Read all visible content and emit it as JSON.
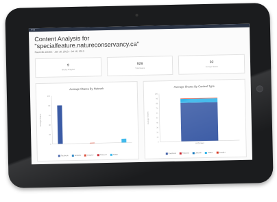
{
  "status_bar": {
    "left": "iPad",
    "center": "",
    "right": ""
  },
  "header": {
    "title_line1": "Content Analysis for",
    "title_line2": "\"specialfeature.natureconservancy.ca\"",
    "subtitle": "Past 10k articles · Jan 16, 2013 – Jul 16, 2013"
  },
  "summary_cards": [
    {
      "value": "9",
      "label": "Articles Analyzed"
    },
    {
      "value": "828",
      "label": "Total Shares"
    },
    {
      "value": "92",
      "label": "Average Shares"
    }
  ],
  "colors": {
    "facebook": "#3b5ba5",
    "google_plus": "#d9412b",
    "linkedin": "#1a7bbf",
    "twitter": "#31b4ea",
    "pinterest": "#c8232c",
    "card_border": "#e3e3e3"
  },
  "chart_data": [
    {
      "type": "bar",
      "title": "Average Shares By Network",
      "ylabel": "Average Shares",
      "categories": [
        "Facebook",
        "LinkedIn",
        "Google+",
        "Pinterest",
        "Twitter"
      ],
      "values": [
        80,
        0,
        1,
        0,
        8
      ],
      "ylim": [
        0,
        100
      ],
      "yticks": [
        0,
        20,
        40,
        60,
        80,
        100
      ],
      "legend": [
        "Facebook",
        "LinkedIn",
        "Google+",
        "Pinterest",
        "Twitter"
      ]
    },
    {
      "type": "bar",
      "title": "Average Shares By Content Type",
      "ylabel": "Average Shares",
      "categories": [
        "All Content"
      ],
      "series": [
        {
          "name": "Facebook",
          "values": [
            80
          ]
        },
        {
          "name": "Twitter",
          "values": [
            8
          ]
        },
        {
          "name": "Google+",
          "values": [
            1
          ]
        },
        {
          "name": "Pinterest",
          "values": [
            0
          ]
        },
        {
          "name": "LinkedIn",
          "values": [
            0
          ]
        }
      ],
      "ylim": [
        0,
        100
      ],
      "yticks": [
        0,
        10,
        20,
        30,
        40,
        50,
        60,
        70,
        80,
        90,
        100
      ],
      "legend": [
        "Facebook",
        "Pinterest",
        "LinkedIn",
        "Twitter",
        "Google+"
      ]
    }
  ]
}
